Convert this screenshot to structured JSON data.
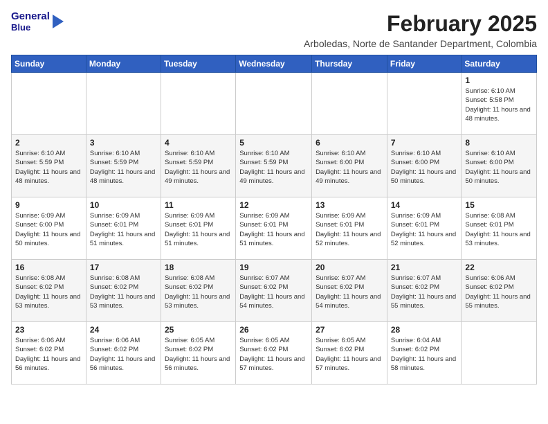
{
  "header": {
    "logo_line1": "General",
    "logo_line2": "Blue",
    "month": "February 2025",
    "location": "Arboledas, Norte de Santander Department, Colombia"
  },
  "weekdays": [
    "Sunday",
    "Monday",
    "Tuesday",
    "Wednesday",
    "Thursday",
    "Friday",
    "Saturday"
  ],
  "weeks": [
    [
      {
        "day": "",
        "sunrise": "",
        "sunset": "",
        "daylight": ""
      },
      {
        "day": "",
        "sunrise": "",
        "sunset": "",
        "daylight": ""
      },
      {
        "day": "",
        "sunrise": "",
        "sunset": "",
        "daylight": ""
      },
      {
        "day": "",
        "sunrise": "",
        "sunset": "",
        "daylight": ""
      },
      {
        "day": "",
        "sunrise": "",
        "sunset": "",
        "daylight": ""
      },
      {
        "day": "",
        "sunrise": "",
        "sunset": "",
        "daylight": ""
      },
      {
        "day": "1",
        "sunrise": "Sunrise: 6:10 AM",
        "sunset": "Sunset: 5:58 PM",
        "daylight": "Daylight: 11 hours and 48 minutes."
      }
    ],
    [
      {
        "day": "2",
        "sunrise": "Sunrise: 6:10 AM",
        "sunset": "Sunset: 5:59 PM",
        "daylight": "Daylight: 11 hours and 48 minutes."
      },
      {
        "day": "3",
        "sunrise": "Sunrise: 6:10 AM",
        "sunset": "Sunset: 5:59 PM",
        "daylight": "Daylight: 11 hours and 48 minutes."
      },
      {
        "day": "4",
        "sunrise": "Sunrise: 6:10 AM",
        "sunset": "Sunset: 5:59 PM",
        "daylight": "Daylight: 11 hours and 49 minutes."
      },
      {
        "day": "5",
        "sunrise": "Sunrise: 6:10 AM",
        "sunset": "Sunset: 5:59 PM",
        "daylight": "Daylight: 11 hours and 49 minutes."
      },
      {
        "day": "6",
        "sunrise": "Sunrise: 6:10 AM",
        "sunset": "Sunset: 6:00 PM",
        "daylight": "Daylight: 11 hours and 49 minutes."
      },
      {
        "day": "7",
        "sunrise": "Sunrise: 6:10 AM",
        "sunset": "Sunset: 6:00 PM",
        "daylight": "Daylight: 11 hours and 50 minutes."
      },
      {
        "day": "8",
        "sunrise": "Sunrise: 6:10 AM",
        "sunset": "Sunset: 6:00 PM",
        "daylight": "Daylight: 11 hours and 50 minutes."
      }
    ],
    [
      {
        "day": "9",
        "sunrise": "Sunrise: 6:09 AM",
        "sunset": "Sunset: 6:00 PM",
        "daylight": "Daylight: 11 hours and 50 minutes."
      },
      {
        "day": "10",
        "sunrise": "Sunrise: 6:09 AM",
        "sunset": "Sunset: 6:01 PM",
        "daylight": "Daylight: 11 hours and 51 minutes."
      },
      {
        "day": "11",
        "sunrise": "Sunrise: 6:09 AM",
        "sunset": "Sunset: 6:01 PM",
        "daylight": "Daylight: 11 hours and 51 minutes."
      },
      {
        "day": "12",
        "sunrise": "Sunrise: 6:09 AM",
        "sunset": "Sunset: 6:01 PM",
        "daylight": "Daylight: 11 hours and 51 minutes."
      },
      {
        "day": "13",
        "sunrise": "Sunrise: 6:09 AM",
        "sunset": "Sunset: 6:01 PM",
        "daylight": "Daylight: 11 hours and 52 minutes."
      },
      {
        "day": "14",
        "sunrise": "Sunrise: 6:09 AM",
        "sunset": "Sunset: 6:01 PM",
        "daylight": "Daylight: 11 hours and 52 minutes."
      },
      {
        "day": "15",
        "sunrise": "Sunrise: 6:08 AM",
        "sunset": "Sunset: 6:01 PM",
        "daylight": "Daylight: 11 hours and 53 minutes."
      }
    ],
    [
      {
        "day": "16",
        "sunrise": "Sunrise: 6:08 AM",
        "sunset": "Sunset: 6:02 PM",
        "daylight": "Daylight: 11 hours and 53 minutes."
      },
      {
        "day": "17",
        "sunrise": "Sunrise: 6:08 AM",
        "sunset": "Sunset: 6:02 PM",
        "daylight": "Daylight: 11 hours and 53 minutes."
      },
      {
        "day": "18",
        "sunrise": "Sunrise: 6:08 AM",
        "sunset": "Sunset: 6:02 PM",
        "daylight": "Daylight: 11 hours and 53 minutes."
      },
      {
        "day": "19",
        "sunrise": "Sunrise: 6:07 AM",
        "sunset": "Sunset: 6:02 PM",
        "daylight": "Daylight: 11 hours and 54 minutes."
      },
      {
        "day": "20",
        "sunrise": "Sunrise: 6:07 AM",
        "sunset": "Sunset: 6:02 PM",
        "daylight": "Daylight: 11 hours and 54 minutes."
      },
      {
        "day": "21",
        "sunrise": "Sunrise: 6:07 AM",
        "sunset": "Sunset: 6:02 PM",
        "daylight": "Daylight: 11 hours and 55 minutes."
      },
      {
        "day": "22",
        "sunrise": "Sunrise: 6:06 AM",
        "sunset": "Sunset: 6:02 PM",
        "daylight": "Daylight: 11 hours and 55 minutes."
      }
    ],
    [
      {
        "day": "23",
        "sunrise": "Sunrise: 6:06 AM",
        "sunset": "Sunset: 6:02 PM",
        "daylight": "Daylight: 11 hours and 56 minutes."
      },
      {
        "day": "24",
        "sunrise": "Sunrise: 6:06 AM",
        "sunset": "Sunset: 6:02 PM",
        "daylight": "Daylight: 11 hours and 56 minutes."
      },
      {
        "day": "25",
        "sunrise": "Sunrise: 6:05 AM",
        "sunset": "Sunset: 6:02 PM",
        "daylight": "Daylight: 11 hours and 56 minutes."
      },
      {
        "day": "26",
        "sunrise": "Sunrise: 6:05 AM",
        "sunset": "Sunset: 6:02 PM",
        "daylight": "Daylight: 11 hours and 57 minutes."
      },
      {
        "day": "27",
        "sunrise": "Sunrise: 6:05 AM",
        "sunset": "Sunset: 6:02 PM",
        "daylight": "Daylight: 11 hours and 57 minutes."
      },
      {
        "day": "28",
        "sunrise": "Sunrise: 6:04 AM",
        "sunset": "Sunset: 6:02 PM",
        "daylight": "Daylight: 11 hours and 58 minutes."
      },
      {
        "day": "",
        "sunrise": "",
        "sunset": "",
        "daylight": ""
      }
    ]
  ]
}
